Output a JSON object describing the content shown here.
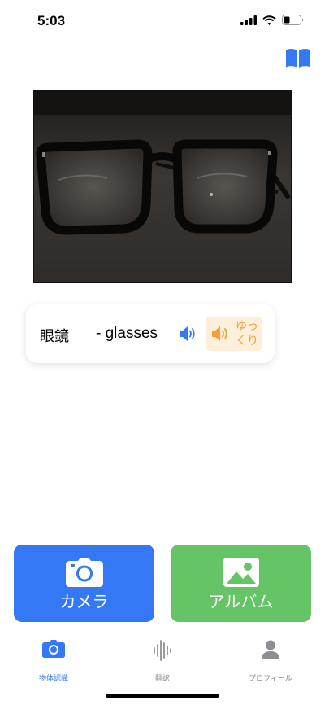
{
  "status_bar": {
    "time": "5:03",
    "icons": [
      "signal-icon",
      "wifi-icon",
      "battery-icon"
    ]
  },
  "header": {
    "bookmark_icon": "book-icon"
  },
  "photo": {
    "subject": "glasses"
  },
  "result": {
    "japanese": "眼鏡",
    "english": "- glasses",
    "speak_icon": "speaker-icon",
    "slow_label_line1": "ゆっ",
    "slow_label_line2": "くり"
  },
  "actions": {
    "camera_label": "カメラ",
    "album_label": "アルバム"
  },
  "tabs": [
    {
      "label": "物体認識",
      "icon": "camera-icon",
      "active": true
    },
    {
      "label": "翻訳",
      "icon": "waveform-icon",
      "active": false
    },
    {
      "label": "プロフィール",
      "icon": "person-icon",
      "active": false
    }
  ],
  "colors": {
    "accent_blue": "#3478f6",
    "album_green": "#65c466",
    "slow_orange": "#f0a23a",
    "slow_bg": "#fdefd9",
    "inactive_tab": "#8e8e93"
  }
}
